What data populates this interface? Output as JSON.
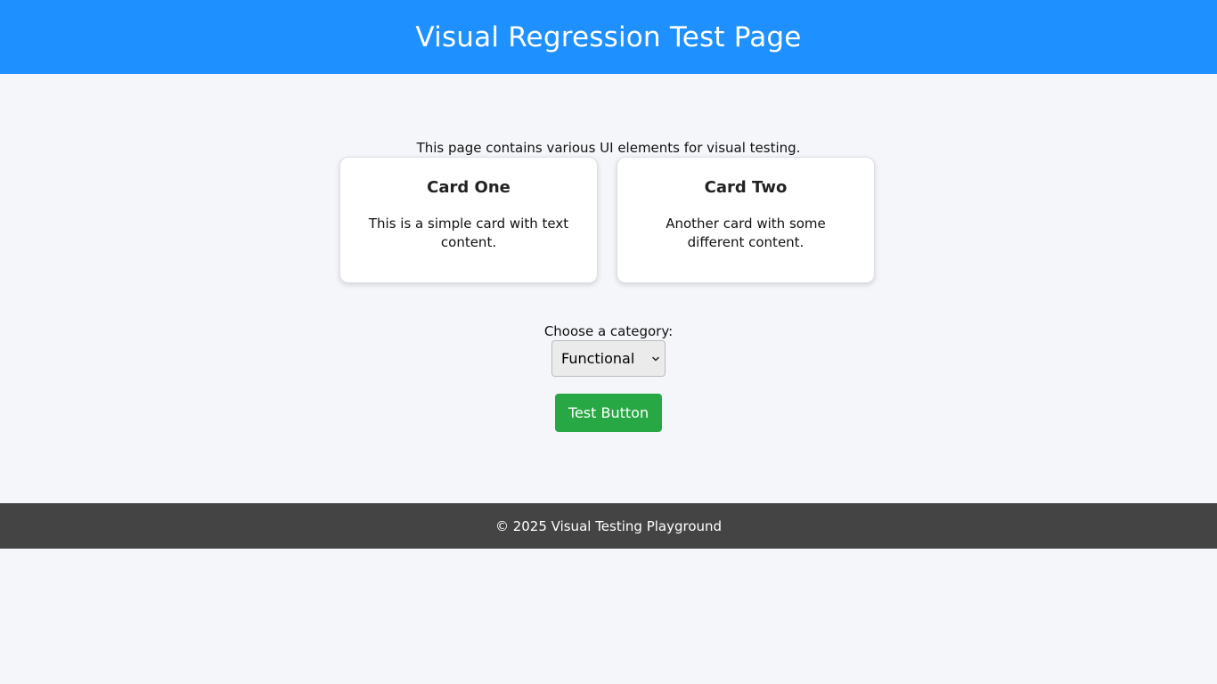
{
  "header": {
    "title": "Visual Regression Test Page"
  },
  "main": {
    "intro": "This page contains various UI elements for visual testing.",
    "cards": [
      {
        "title": "Card One",
        "text": "This is a simple card with text content."
      },
      {
        "title": "Card Two",
        "text": "Another card with some different content."
      }
    ],
    "category": {
      "label": "Choose a category:",
      "selected": "Functional",
      "icon": "chevron-down-icon"
    },
    "button_label": "Test Button"
  },
  "footer": {
    "text": "© 2025 Visual Testing Playground"
  },
  "colors": {
    "header_bg": "#1e90ff",
    "page_bg": "#f4f6fa",
    "button_bg": "#28a745",
    "footer_bg": "#444444"
  }
}
